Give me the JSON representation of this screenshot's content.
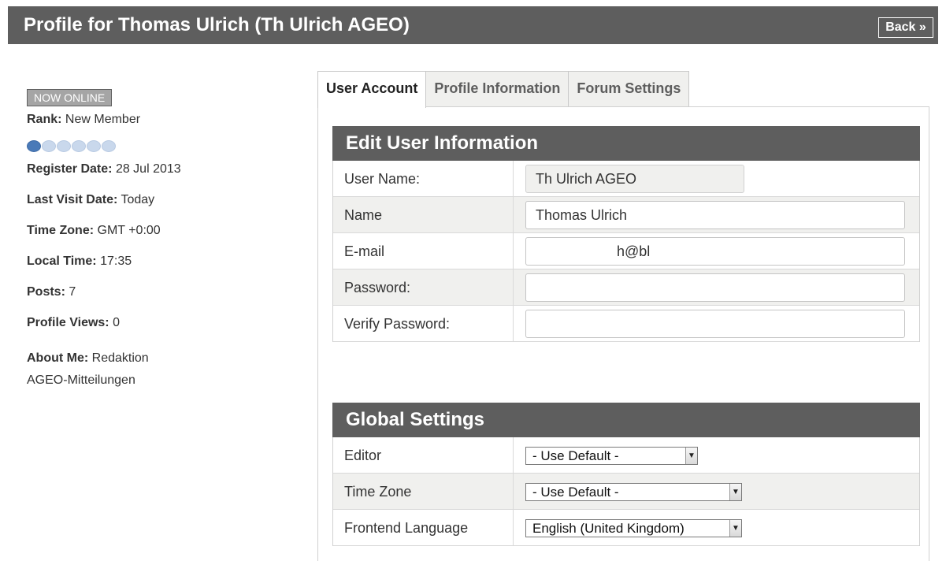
{
  "header": {
    "title": "Profile for Thomas Ulrich (Th Ulrich AGEO)",
    "back_label": "Back »"
  },
  "sidebar": {
    "online_badge": "NOW ONLINE",
    "rank_label": "Rank:",
    "rank_value": "New Member",
    "rank_level": {
      "filled": 1,
      "total": 6
    },
    "register_label": "Register Date:",
    "register_value": "28 Jul 2013",
    "last_visit_label": "Last Visit Date:",
    "last_visit_value": "Today",
    "timezone_label": "Time Zone:",
    "timezone_value": "GMT +0:00",
    "local_time_label": "Local Time:",
    "local_time_value": "17:35",
    "posts_label": "Posts:",
    "posts_value": "7",
    "profile_views_label": "Profile Views:",
    "profile_views_value": "0",
    "about_label": "About Me:",
    "about_value_1": "Redaktion",
    "about_value_2": "AGEO-Mitteilungen"
  },
  "tabs": [
    {
      "label": "User Account",
      "active": true
    },
    {
      "label": "Profile Information",
      "active": false
    },
    {
      "label": "Forum Settings",
      "active": false
    }
  ],
  "edit_user": {
    "heading": "Edit User Information",
    "username_label": "User Name:",
    "username_value": "Th Ulrich AGEO",
    "name_label": "Name",
    "name_value": "Thomas Ulrich",
    "email_label": "E-mail",
    "email_value": "h@bl",
    "password_label": "Password:",
    "password_value": "",
    "verify_label": "Verify Password:",
    "verify_value": ""
  },
  "global_settings": {
    "heading": "Global Settings",
    "editor_label": "Editor",
    "editor_value": "- Use Default -",
    "timezone_label": "Time Zone",
    "timezone_value": "- Use Default -",
    "language_label": "Frontend Language",
    "language_value": "English (United Kingdom)"
  },
  "colors": {
    "header_bg": "#5e5e5e",
    "row_alt_bg": "#f0f0ee",
    "rank_dot_filled": "#4a7ab8",
    "rank_dot_empty": "#c9d8ec"
  }
}
